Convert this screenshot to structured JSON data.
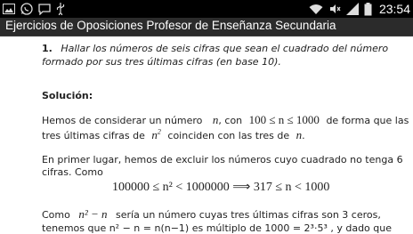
{
  "status_bar": {
    "clock": "23:54",
    "icons_left": [
      "image-icon",
      "whatsapp-icon",
      "chat-bubble-icon",
      "usb-icon"
    ],
    "icons_right": [
      "wifi-icon",
      "mute-icon",
      "signal-icon",
      "battery-icon"
    ]
  },
  "title_bar": {
    "title": "Ejercicios de Oposiciones Profesor de Enseñanza Secundaria"
  },
  "exercise": {
    "number": "1.",
    "statement_line1": "Hallar los números de seis cifras que sean el cuadrado del número",
    "statement_line2": "formado por sus tres últimas cifras (en base 10)."
  },
  "solution": {
    "heading": "Solución:",
    "p1": {
      "a": "Hemos de considerar un número",
      "n": "n",
      "b": ", con",
      "ineq": "100 ≤ n ≤ 1000",
      "c": "de forma que las",
      "line2_a": "tres últimas cifras de",
      "n2": "n",
      "line2_b": "coinciden con las tres de",
      "n3": "n",
      "line2_c": "."
    },
    "p2": {
      "line1": "En primer lugar, hemos de excluir los números cuyo cuadrado no tenga 6",
      "line2": "cifras. Como"
    },
    "formula": "100000 ≤ n² < 1000000 ⟹ 317 ≤ n < 1000",
    "p3": {
      "a": "Como",
      "expr": "n² − n",
      "b": "sería un número cuyas tres últimas cifras son 3 ceros,"
    },
    "p4_partial": "tenemos que  n² − n = n(n−1)  es múltiplo de  1000 = 2³·5³  , y dado que"
  },
  "colors": {
    "status_bg": "#000000",
    "title_bg": "#2b2b2b",
    "page_bg": "#ffffff"
  }
}
